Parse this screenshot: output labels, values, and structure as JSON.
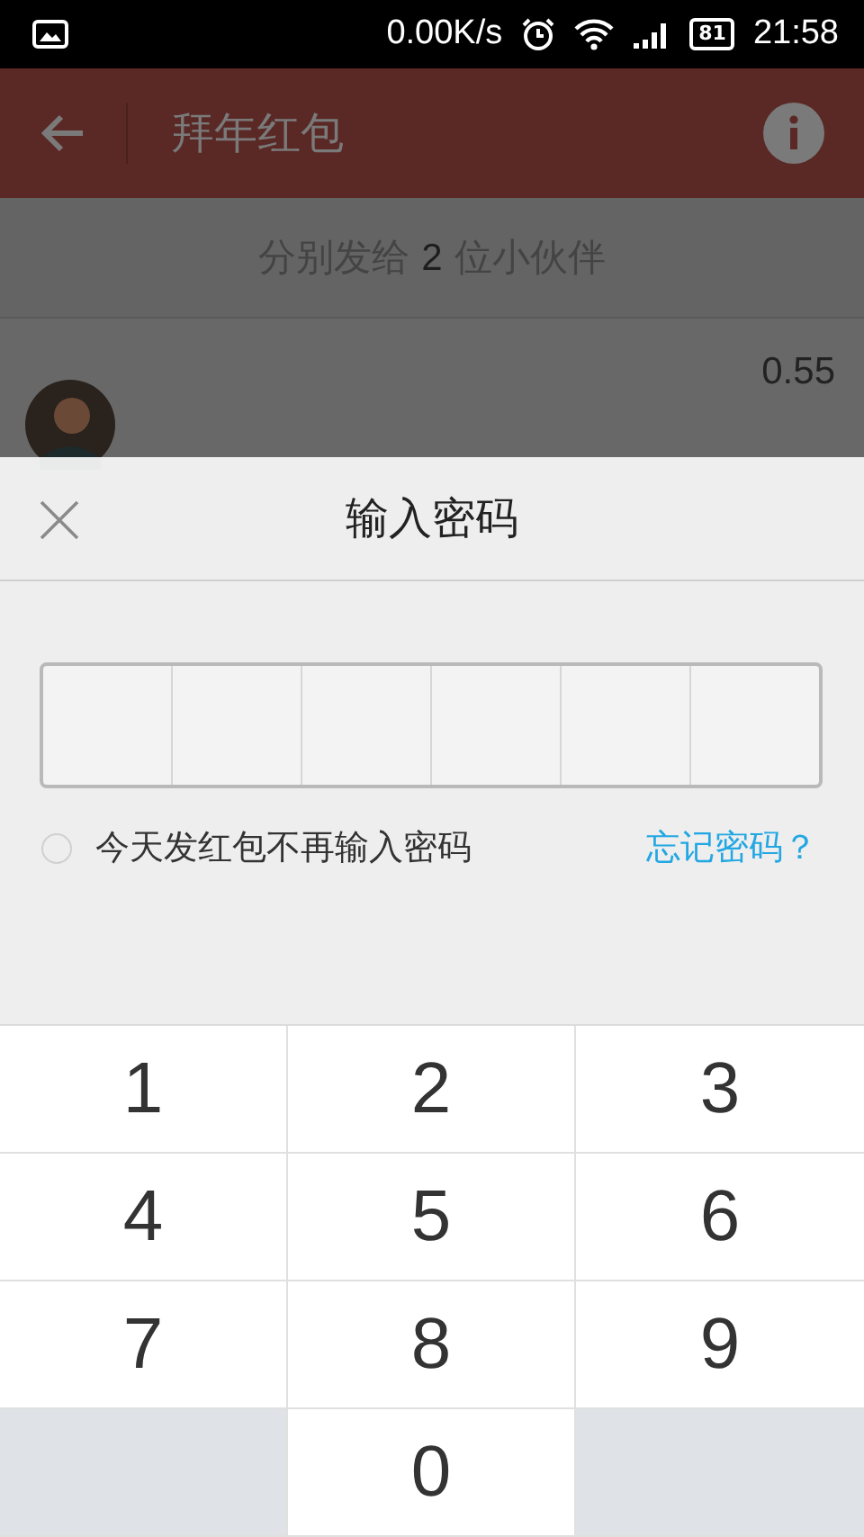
{
  "status_bar": {
    "speed": "0.00K/s",
    "battery": "81",
    "time": "21:58"
  },
  "app_bar": {
    "title": "拜年红包"
  },
  "subtitle": {
    "before": "分别发给",
    "count": "2",
    "after": "位小伙伴"
  },
  "recipients": [
    {
      "amount": "0.55"
    }
  ],
  "dialog": {
    "title": "输入密码",
    "remember": {
      "label": "今天发红包不再输入密码",
      "checked": false
    },
    "forgot_link": "忘记密码？"
  },
  "keypad": [
    {
      "kind": "digit",
      "label": "1"
    },
    {
      "kind": "digit",
      "label": "2"
    },
    {
      "kind": "digit",
      "label": "3"
    },
    {
      "kind": "digit",
      "label": "4"
    },
    {
      "kind": "digit",
      "label": "5"
    },
    {
      "kind": "digit",
      "label": "6"
    },
    {
      "kind": "digit",
      "label": "7"
    },
    {
      "kind": "digit",
      "label": "8"
    },
    {
      "kind": "digit",
      "label": "9"
    },
    {
      "kind": "blank"
    },
    {
      "kind": "digit",
      "label": "0"
    },
    {
      "kind": "blank"
    }
  ]
}
